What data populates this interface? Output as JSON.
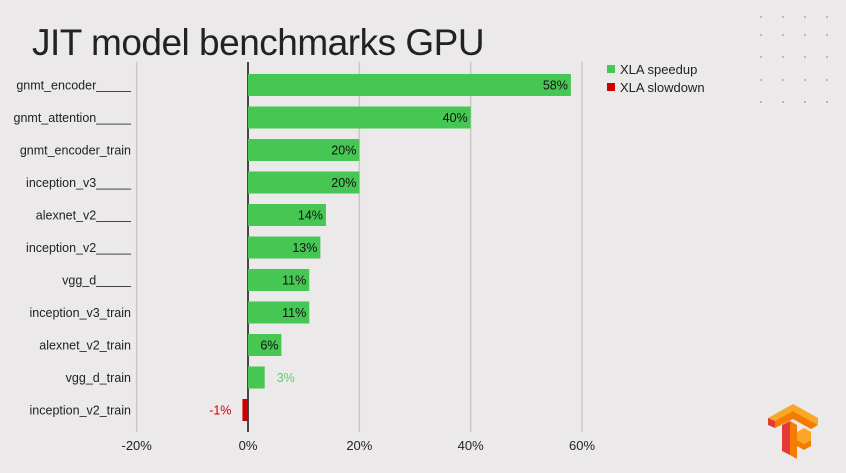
{
  "chart_data": {
    "type": "bar",
    "orientation": "horizontal",
    "title": "JIT model benchmarks GPU",
    "categories": [
      "gnmt_encoder_____",
      "gnmt_attention_____",
      "gnmt_encoder_train",
      "inception_v3_____",
      "alexnet_v2_____",
      "inception_v2_____",
      "vgg_d_____",
      "inception_v3_train",
      "alexnet_v2_train",
      "vgg_d_train",
      "inception_v2_train"
    ],
    "values": [
      58,
      40,
      20,
      20,
      14,
      13,
      11,
      11,
      6,
      3,
      -1
    ],
    "data_labels": [
      "58%",
      "40%",
      "20%",
      "20%",
      "14%",
      "13%",
      "11%",
      "11%",
      "6%",
      "3%",
      "-1%"
    ],
    "xlim": [
      -20,
      60
    ],
    "x_ticks": [
      -20,
      0,
      20,
      40,
      60
    ],
    "x_tick_labels": [
      "-20%",
      "0%",
      "20%",
      "40%",
      "60%"
    ],
    "grid": true,
    "legend": {
      "placement": "top-right",
      "entries": [
        {
          "name": "XLA speedup",
          "color": "#46c653"
        },
        {
          "name": "XLA slowdown",
          "color": "#cc0000"
        }
      ]
    },
    "colors": {
      "speedup": "#46c653",
      "slowdown": "#cc0000",
      "label_light_green": "#5fcf6b"
    }
  },
  "logo": {
    "name": "tensorflow-logo",
    "colors": [
      "#f9a825",
      "#f57c00",
      "#e53935"
    ]
  }
}
